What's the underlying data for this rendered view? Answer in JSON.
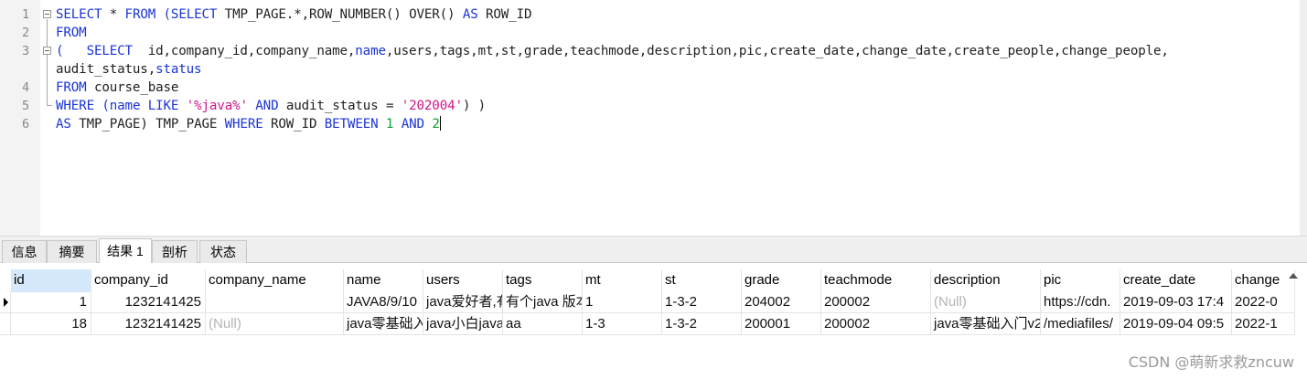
{
  "editor": {
    "line_numbers": [
      "1",
      "2",
      "3",
      "4",
      "5",
      "6"
    ],
    "lines": [
      [
        {
          "t": "kw",
          "v": "SELECT"
        },
        {
          "t": "txt",
          "v": " * "
        },
        {
          "t": "kw",
          "v": "FROM"
        },
        {
          "t": "txt",
          "v": " "
        },
        {
          "t": "kw",
          "v": "(SELECT"
        },
        {
          "t": "txt",
          "v": " TMP_PAGE.*,ROW_NUMBER() OVER() "
        },
        {
          "t": "kw",
          "v": "AS"
        },
        {
          "t": "txt",
          "v": " ROW_ID"
        }
      ],
      [
        {
          "t": "kw",
          "v": "FROM"
        }
      ],
      [
        {
          "t": "kw",
          "v": "(   SELECT"
        },
        {
          "t": "txt",
          "v": "  id,company_id,company_name,"
        },
        {
          "t": "kw",
          "v": "name"
        },
        {
          "t": "txt",
          "v": ",users,tags,mt,st,grade,teachmode,description,pic,create_date,change_date,create_people,change_people,"
        }
      ],
      [
        {
          "t": "txt",
          "v": "audit_status,"
        },
        {
          "t": "kw",
          "v": "status"
        }
      ],
      [
        {
          "t": "kw",
          "v": "FROM"
        },
        {
          "t": "txt",
          "v": " course_base"
        }
      ],
      [
        {
          "t": "kw",
          "v": "WHERE"
        },
        {
          "t": "txt",
          "v": " "
        },
        {
          "t": "kw",
          "v": "(name"
        },
        {
          "t": "txt",
          "v": " "
        },
        {
          "t": "kw",
          "v": "LIKE"
        },
        {
          "t": "txt",
          "v": " "
        },
        {
          "t": "str",
          "v": "'%java%'"
        },
        {
          "t": "txt",
          "v": " "
        },
        {
          "t": "kw",
          "v": "AND"
        },
        {
          "t": "txt",
          "v": " audit_status = "
        },
        {
          "t": "str",
          "v": "'202004'"
        },
        {
          "t": "txt",
          "v": ") )"
        }
      ],
      [
        {
          "t": "kw",
          "v": "AS"
        },
        {
          "t": "txt",
          "v": " TMP_PAGE) TMP_PAGE "
        },
        {
          "t": "kw",
          "v": "WHERE"
        },
        {
          "t": "txt",
          "v": " ROW_ID "
        },
        {
          "t": "kw",
          "v": "BETWEEN"
        },
        {
          "t": "txt",
          "v": " "
        },
        {
          "t": "num",
          "v": "1"
        },
        {
          "t": "txt",
          "v": " "
        },
        {
          "t": "kw",
          "v": "AND"
        },
        {
          "t": "txt",
          "v": " "
        },
        {
          "t": "num",
          "v": "2"
        }
      ]
    ]
  },
  "tabs": {
    "info": "信息",
    "summary": "摘要",
    "result1": "结果 1",
    "profile": "剖析",
    "status": "状态"
  },
  "grid": {
    "columns": [
      "id",
      "company_id",
      "company_name",
      "name",
      "users",
      "tags",
      "mt",
      "st",
      "grade",
      "teachmode",
      "description",
      "pic",
      "create_date",
      "change"
    ],
    "rows": [
      [
        "1",
        "1232141425",
        "",
        "JAVA8/9/10",
        "java爱好者,有",
        "有个java 版本",
        "1",
        "1-3-2",
        "204002",
        "200002",
        "(Null)",
        "https://cdn.",
        "2019-09-03 17:4",
        "2022-0"
      ],
      [
        "18",
        "1232141425",
        "(Null)",
        "java零基础入",
        "java小白java",
        "aa",
        "1-3",
        "1-3-2",
        "200001",
        "200002",
        "java零基础入门v2",
        "/mediafiles/",
        "2019-09-04 09:5",
        "2022-1"
      ]
    ]
  },
  "watermark": "CSDN @萌新求救zncuw",
  "colors": {
    "keyword": "#1a34d6",
    "string": "#d0148a",
    "number": "#0aa034",
    "null": "#b5b5b5",
    "selected_header": "#d6e8fb"
  }
}
